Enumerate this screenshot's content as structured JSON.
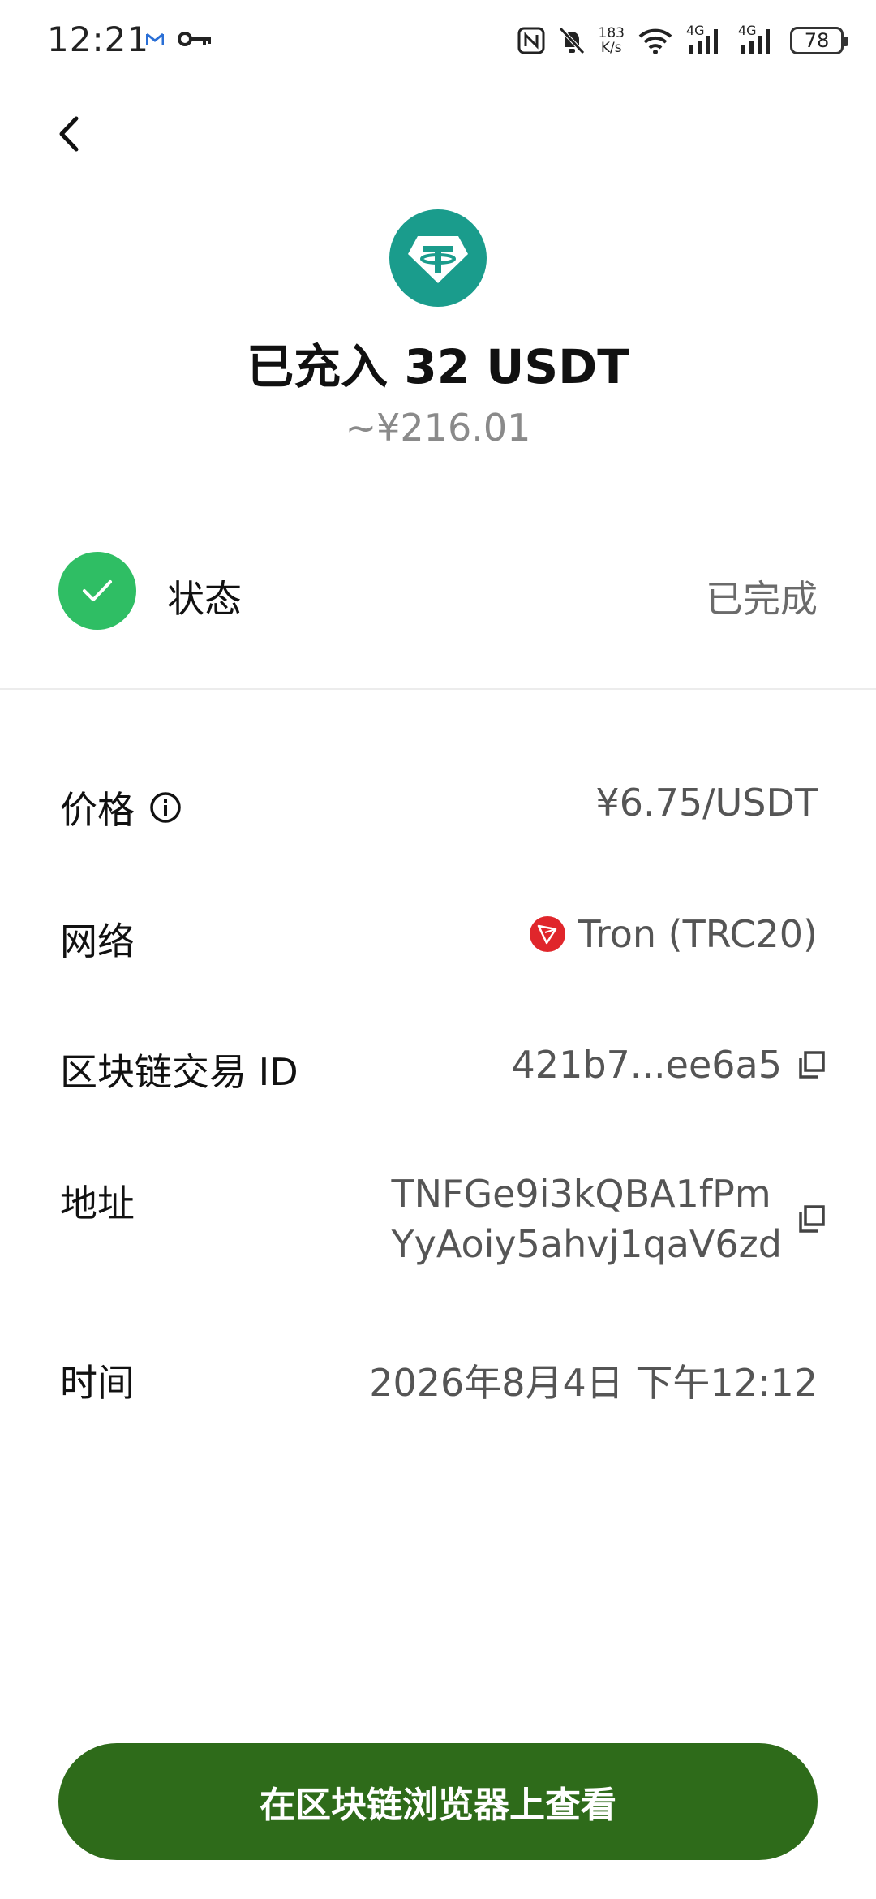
{
  "status_bar": {
    "time": "12:21",
    "net_speed_value": "183",
    "net_speed_unit": "K/s",
    "signal_1_label": "4G",
    "signal_2_label": "4G",
    "battery": "78"
  },
  "header": {
    "title": "已充入 32 USDT",
    "fiat_value": "~¥216.01",
    "token_icon": "tether-icon",
    "token_color": "#1a9c8c"
  },
  "status": {
    "label": "状态",
    "value": "已完成",
    "icon": "check-icon",
    "color": "#2fbe64"
  },
  "details": {
    "price": {
      "label": "价格",
      "value": "¥6.75/USDT"
    },
    "network": {
      "label": "网络",
      "value": "Tron (TRC20)",
      "icon": "tron-icon",
      "icon_color": "#e0262b"
    },
    "tx_id": {
      "label": "区块链交易 ID",
      "value": "421b7...ee6a5"
    },
    "address": {
      "label": "地址",
      "value_line1": "TNFGe9i3kQBA1fPm",
      "value_line2": "YyAoiy5ahvj1qaV6zd"
    },
    "time": {
      "label": "时间",
      "value": "2026年8月4日 下午12:12"
    }
  },
  "actions": {
    "explorer_button": "在区块链浏览器上查看",
    "button_color": "#2e6b1a"
  }
}
